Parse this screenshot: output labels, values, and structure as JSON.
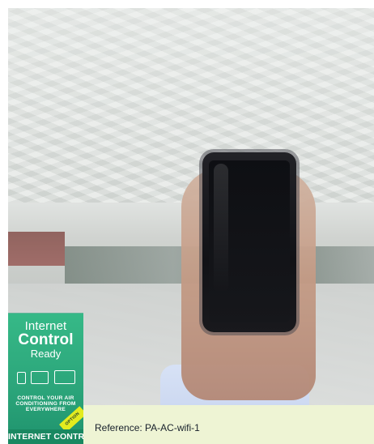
{
  "panel": {
    "title_line1": "Internet",
    "title_line2": "Control",
    "title_line3": "Ready",
    "tagline": "CONTROL YOUR AIR CONDITIONING FROM EVERYWHERE",
    "footer_label": "INTERNET CONTROL",
    "corner_tag": "OPTION"
  },
  "reference": {
    "text": "Reference: PA-AC-wifi-1"
  },
  "icons": [
    "phone-icon",
    "tablet-icon",
    "laptop-icon"
  ],
  "colors": {
    "panel_top": "#36b987",
    "panel_bottom": "#198861",
    "tag": "#e3eb1f",
    "strip_bg": "#eef4d4"
  }
}
